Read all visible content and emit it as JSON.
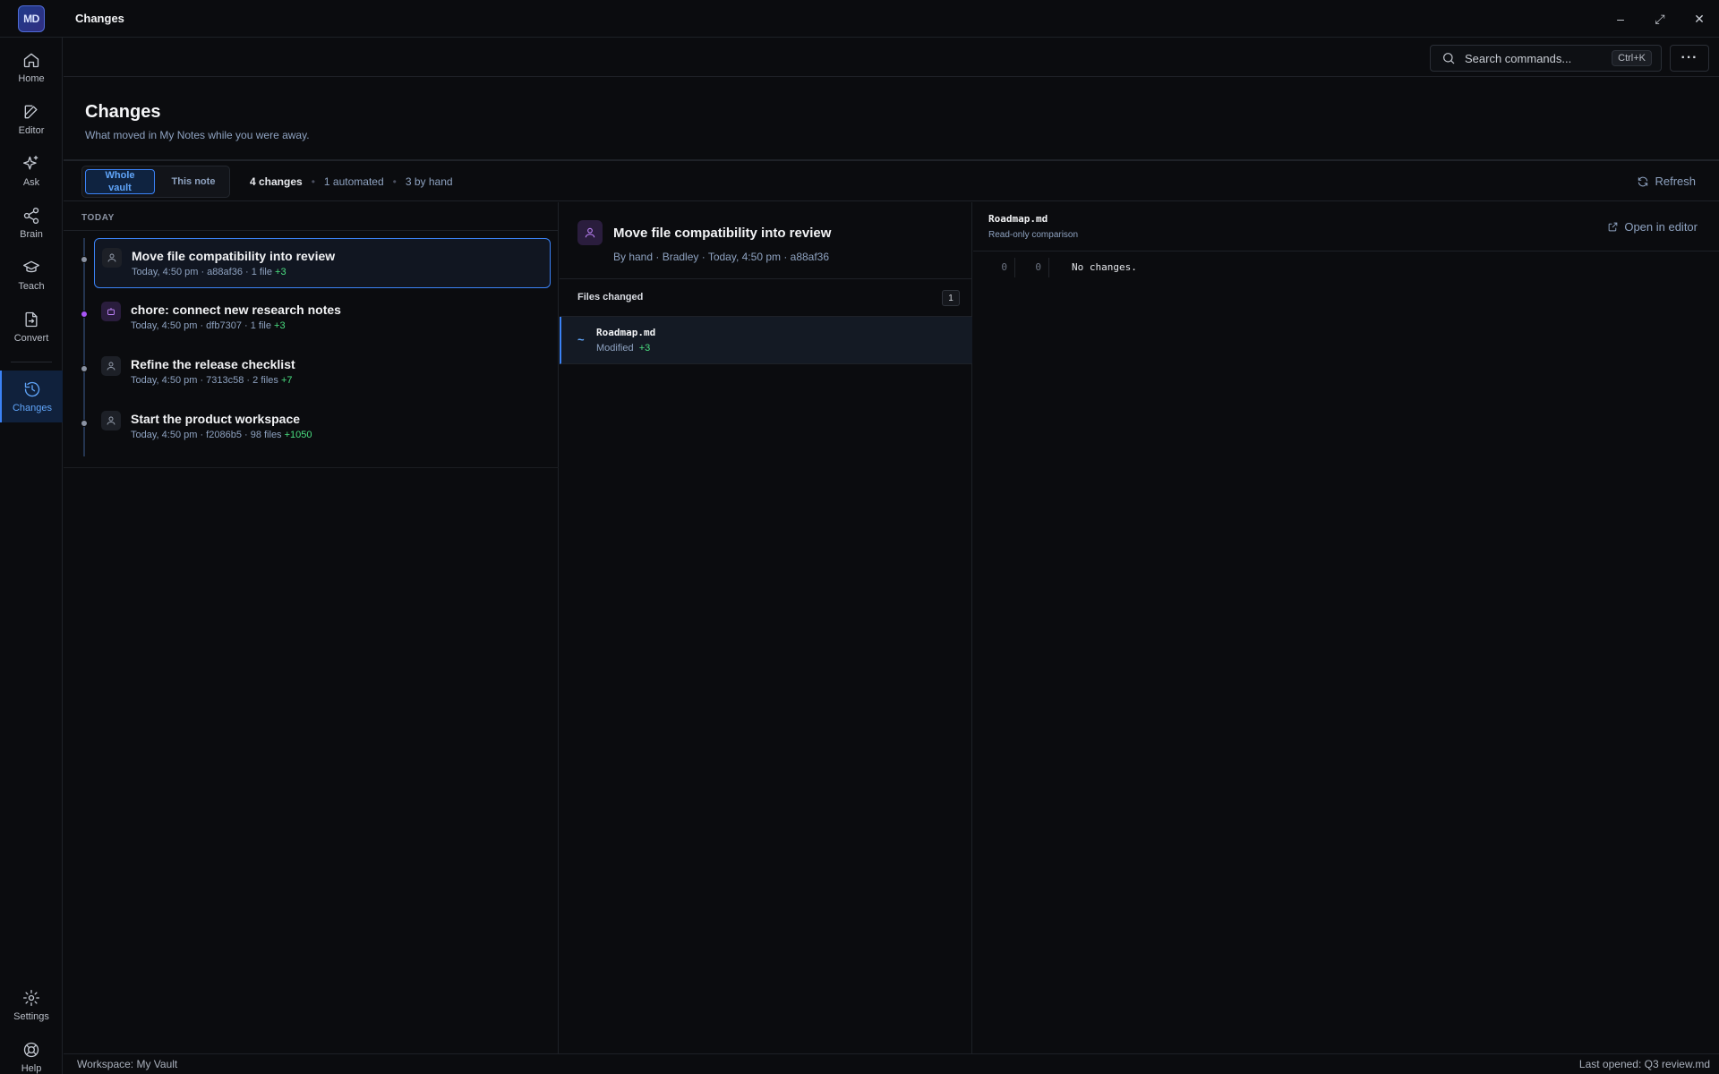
{
  "app": {
    "logo_text": "MD",
    "window_title": "Changes",
    "controls": [
      "–",
      "⤢",
      "✕"
    ]
  },
  "sidebar": {
    "items": [
      {
        "label": "Home",
        "icon": "home-icon"
      },
      {
        "label": "Editor",
        "icon": "edit-icon"
      },
      {
        "label": "Ask",
        "icon": "sparkle-icon"
      },
      {
        "label": "Brain",
        "icon": "share-nodes-icon"
      },
      {
        "label": "Teach",
        "icon": "graduation-cap-icon"
      },
      {
        "label": "Convert",
        "icon": "file-convert-icon"
      },
      {
        "label": "Changes",
        "icon": "history-icon",
        "active": true
      }
    ],
    "bottom": [
      {
        "label": "Settings",
        "icon": "gear-icon"
      },
      {
        "label": "Help",
        "icon": "lifebuoy-icon"
      }
    ]
  },
  "topbar": {
    "search_placeholder": "Search commands...",
    "shortcut": "Ctrl+K",
    "more_label": "···"
  },
  "page": {
    "title": "Changes",
    "subtitle": "What moved in My Notes while you were away."
  },
  "filters": {
    "scope_options": [
      "Whole vault",
      "This note"
    ],
    "selected_scope": "Whole vault",
    "total": "4 changes",
    "automated": "1 automated",
    "manual": "3 by hand",
    "refresh_label": "Refresh"
  },
  "timeline": {
    "day_label": "TODAY",
    "commits": [
      {
        "title": "Move file compatibility into review",
        "meta": "Today, 4:50 pm · a88af36 · 1 file",
        "additions": "+3",
        "kind": "person",
        "selected": true
      },
      {
        "title": "chore: connect new research notes",
        "meta": "Today, 4:50 pm · dfb7307 · 1 file",
        "additions": "+3",
        "kind": "bot",
        "selected": false
      },
      {
        "title": "Refine the release checklist",
        "meta": "Today, 4:50 pm · 7313c58 · 2 files",
        "additions": "+7",
        "kind": "person",
        "selected": false
      },
      {
        "title": "Start the product workspace",
        "meta": "Today, 4:50 pm · f2086b5 · 98 files",
        "additions": "+1050",
        "kind": "person",
        "selected": false
      }
    ]
  },
  "detail": {
    "title": "Move file compatibility into review",
    "meta": "By hand · Bradley · Today, 4:50 pm · a88af36",
    "files_label": "Files changed",
    "files_count": "1",
    "files": [
      {
        "glyph": "~",
        "name": "Roadmap.md",
        "state": "Modified",
        "additions": "+3"
      }
    ]
  },
  "diff": {
    "file": "Roadmap.md",
    "subtitle": "Read-only comparison",
    "open_label": "Open in editor",
    "rows": [
      {
        "old": "0",
        "new": "0",
        "text": "No changes."
      }
    ]
  },
  "statusbar": {
    "left": "Workspace: My Vault",
    "right": "Last opened: Q3 review.md"
  },
  "colors": {
    "accent": "#3b82f6",
    "accent_text": "#60a5fa",
    "addition": "#4ade80",
    "automation": "#a855f7",
    "background": "#0b0c0f"
  }
}
